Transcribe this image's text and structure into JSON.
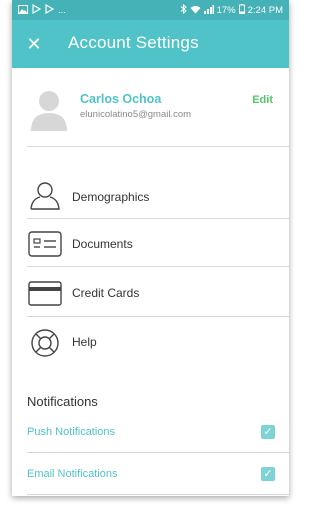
{
  "status_bar": {
    "left_icons": [
      "image-icon",
      "play-store-icon",
      "play-store-icon"
    ],
    "ellipsis": "...",
    "battery_percent": "17%",
    "time": "2:24 PM"
  },
  "header": {
    "close_glyph": "✕",
    "title": "Account Settings",
    "background": "#4fc3c8"
  },
  "profile": {
    "name": "Carlos Ochoa",
    "email": "elunicolatino5@gmail.com",
    "edit_label": "Edit",
    "edit_color": "#56c46f"
  },
  "menu": {
    "items": [
      {
        "label": "Demographics",
        "icon": "person-outline-icon"
      },
      {
        "label": "Documents",
        "icon": "id-card-icon"
      },
      {
        "label": "Credit Cards",
        "icon": "credit-card-icon"
      },
      {
        "label": "Help",
        "icon": "lifebuoy-icon"
      }
    ]
  },
  "notifications": {
    "title": "Notifications",
    "toggles": [
      {
        "label": "Push Notifications",
        "checked": true
      },
      {
        "label": "Email Notifications",
        "checked": true
      }
    ]
  },
  "accent": "#4fc3c8"
}
